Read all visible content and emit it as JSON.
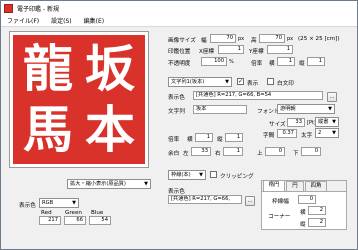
{
  "window": {
    "title": "電子印鑑 - 新規"
  },
  "menu": [
    "ファイル(F)",
    "設定(S)",
    "編集(E)"
  ],
  "stamp": {
    "chars": [
      "坂",
      "本",
      "龍",
      "馬"
    ],
    "color": "#d9322b"
  },
  "image": {
    "size_label": "画像サイズ",
    "width_label": "幅",
    "width": "70",
    "width_unit": "px",
    "height_label": "高",
    "height": "70",
    "height_unit": "px",
    "cm_note": "(25 × 25 [cm])",
    "print_pos_label": "印鑑位置",
    "x_pos_label": "X座標",
    "x_pos": "1",
    "y_pos_label": "Y座標",
    "y_pos": "1",
    "opacity_label": "不透明度",
    "opacity": "100",
    "opacity_unit": "%",
    "scale_label": "倍率",
    "scale_w_label": "横",
    "scale_w": "1",
    "scale_h_label": "縦",
    "scale_h": "1"
  },
  "text": {
    "layer_select": "文字列1(坂本)",
    "show_label": "表示",
    "show_checked": true,
    "white_label": "白文印",
    "white_checked": false,
    "color_label": "表示色",
    "color_value": "[共通色] R=217, G=66, B=54",
    "string_label": "文字列",
    "string_value": "坂本",
    "font_label": "フォント",
    "font_value": "游明朝",
    "size_label": "サイズ",
    "size_value": "33",
    "size_unit": "[Pt]",
    "direction_value": "縦書",
    "spacing_label": "字間",
    "spacing_value": "0.37",
    "weight_label": "太字",
    "weight_value": "2",
    "scale_label": "倍率",
    "scale_w_label": "横",
    "scale_w": "1",
    "scale_h_label": "縦",
    "scale_h": "1",
    "margin_label": "余白",
    "left_label": "左",
    "left": "33",
    "right_label": "右",
    "right": "1",
    "top_label": "上",
    "top": "0",
    "bottom_label": "下",
    "bottom": "0"
  },
  "view": {
    "zoom_select": "拡大・縮小表示(原品質)"
  },
  "display": {
    "color_label": "表示色",
    "mode": "RGB",
    "red_label": "Red",
    "red": "217",
    "green_label": "Green",
    "green": "66",
    "blue_label": "Blue",
    "blue": "54"
  },
  "frame": {
    "select": "枠線(本)",
    "clip_label": "クリッピング",
    "color_label": "表示色",
    "color_value": "[共通色] R=217, G=66, B=54",
    "tabs": [
      "楕円",
      "円",
      "四角"
    ],
    "width_label": "枠線幅",
    "width": "0",
    "corner_label": "コーナー",
    "corner_w_label": "横",
    "corner_w": "2",
    "corner_h_label": "縦",
    "corner_h": "2"
  },
  "colors": {
    "stamp_red": "#d9322b",
    "display_swatch": "#d94236"
  }
}
